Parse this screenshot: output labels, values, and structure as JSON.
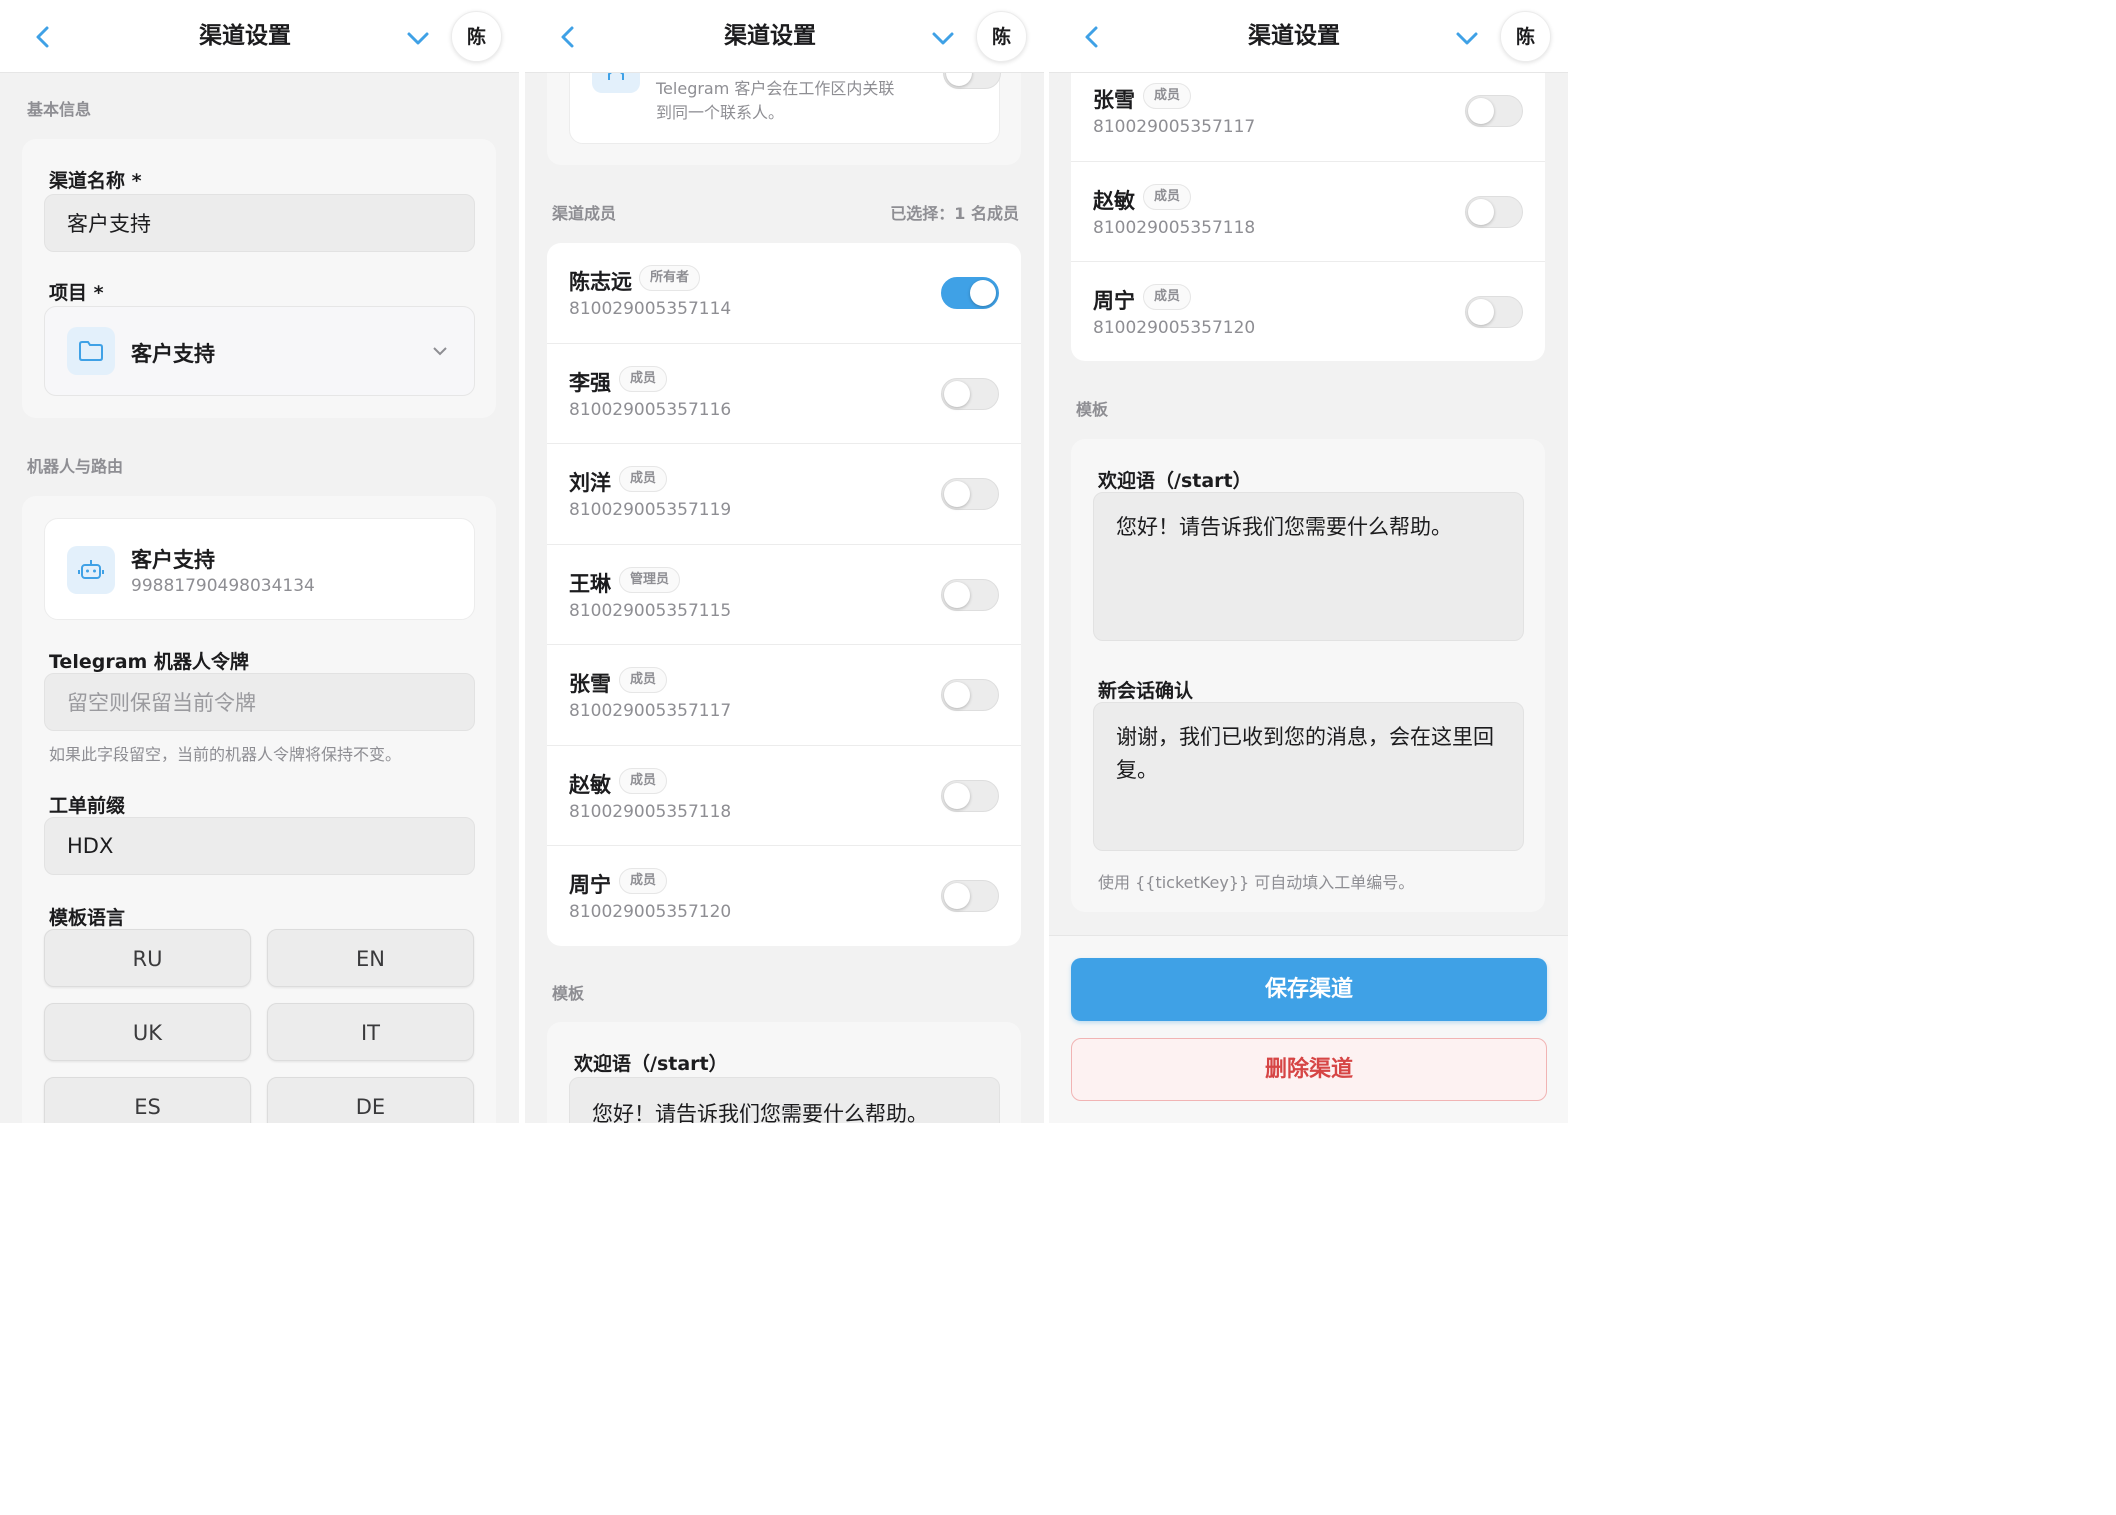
{
  "header": {
    "title": "渠道设置",
    "avatar": "陈"
  },
  "panel1": {
    "basic_section": "基本信息",
    "channel_name_label": "渠道名称 *",
    "channel_name_value": "客户支持",
    "project_label": "项目 *",
    "project_value": "客户支持",
    "bot_section": "机器人与路由",
    "bot_name": "客户支持",
    "bot_id": "99881790498034134",
    "token_label": "Telegram 机器人令牌",
    "token_placeholder": "留空则保留当前令牌",
    "token_hint": "如果此字段留空，当前的机器人令牌将保持不变。",
    "prefix_label": "工单前缀",
    "prefix_value": "HDX",
    "lang_label": "模板语言",
    "languages": [
      "RU",
      "EN",
      "UK",
      "IT",
      "ES",
      "DE"
    ]
  },
  "panel2": {
    "partial_info_line1": "Telegram 客户会在工作区内关联",
    "partial_info_line2": "到同一个联系人。",
    "members_section": "渠道成员",
    "selected_text": "已选择：1 名成员",
    "members": [
      {
        "name": "陈志远",
        "role": "所有者",
        "id": "810029005357114",
        "enabled": true
      },
      {
        "name": "李强",
        "role": "成员",
        "id": "810029005357116",
        "enabled": false
      },
      {
        "name": "刘洋",
        "role": "成员",
        "id": "810029005357119",
        "enabled": false
      },
      {
        "name": "王琳",
        "role": "管理员",
        "id": "810029005357115",
        "enabled": false
      },
      {
        "name": "张雪",
        "role": "成员",
        "id": "810029005357117",
        "enabled": false
      },
      {
        "name": "赵敏",
        "role": "成员",
        "id": "810029005357118",
        "enabled": false
      },
      {
        "name": "周宁",
        "role": "成员",
        "id": "810029005357120",
        "enabled": false
      }
    ],
    "template_section": "模板",
    "welcome_label": "欢迎语（/start）",
    "welcome_partial": "您好！请告诉我们您需要什么帮助。"
  },
  "panel3": {
    "members": [
      {
        "name": "张雪",
        "role": "成员",
        "id": "810029005357117",
        "enabled": false
      },
      {
        "name": "赵敏",
        "role": "成员",
        "id": "810029005357118",
        "enabled": false
      },
      {
        "name": "周宁",
        "role": "成员",
        "id": "810029005357120",
        "enabled": false
      }
    ],
    "template_section": "模板",
    "welcome_label": "欢迎语（/start）",
    "welcome_value": "您好！请告诉我们您需要什么帮助。",
    "confirm_label": "新会话确认",
    "confirm_value": "谢谢，我们已收到您的消息，会在这里回复。",
    "template_hint": "使用 {{ticketKey}} 可自动填入工单编号。",
    "save_button": "保存渠道",
    "delete_button": "删除渠道"
  },
  "colors": {
    "accent": "#3fa1e6",
    "danger": "#d64545",
    "background": "#f2f2f2"
  },
  "icons": {
    "back": "chevron-left-icon",
    "menu": "chevron-down-icon",
    "folder": "folder-icon",
    "bot": "robot-icon",
    "contact": "contact-icon"
  }
}
